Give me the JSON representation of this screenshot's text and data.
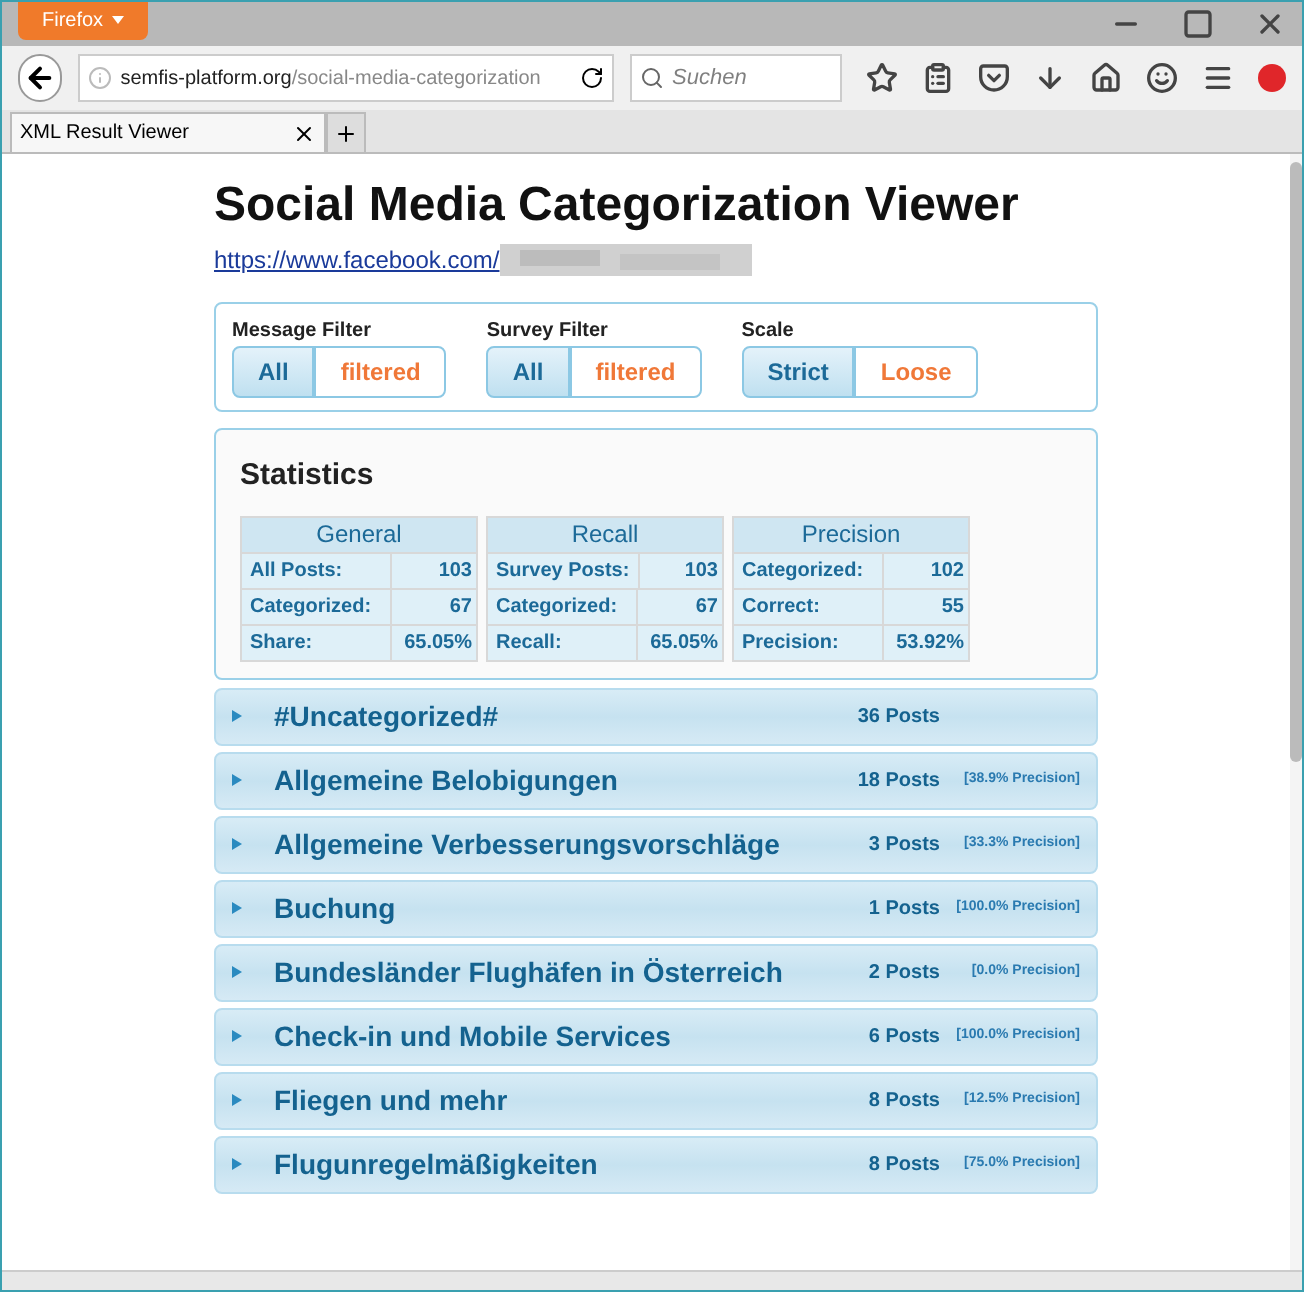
{
  "browser": {
    "menu_button": "Firefox",
    "url_host": "semfis-platform.org",
    "url_path": "/social-media-categorization",
    "search": {
      "placeholder": "Suchen"
    },
    "tabs": [
      {
        "label": "XML Result Viewer",
        "selected": true
      }
    ]
  },
  "page": {
    "title": "Social Media Categorization Viewer",
    "link": "https://www.facebook.com/",
    "filters": [
      {
        "label": "Message Filter",
        "options": [
          {
            "label": "All",
            "selected": true
          },
          {
            "label": "filtered",
            "selected": false
          }
        ]
      },
      {
        "label": "Survey Filter",
        "options": [
          {
            "label": "All",
            "selected": true
          },
          {
            "label": "filtered",
            "selected": false
          }
        ]
      },
      {
        "label": "Scale",
        "options": [
          {
            "label": "Strict",
            "selected": true
          },
          {
            "label": "Loose",
            "selected": false
          }
        ]
      }
    ],
    "statistics": {
      "title": "Statistics",
      "tables": [
        {
          "heading": "General",
          "rows": [
            [
              "All Posts:",
              "103"
            ],
            [
              "Categorized:",
              "67"
            ],
            [
              "Share:",
              "65.05%"
            ]
          ]
        },
        {
          "heading": "Recall",
          "rows": [
            [
              "Survey Posts:",
              "103"
            ],
            [
              "Categorized:",
              "67"
            ],
            [
              "Recall:",
              "65.05%"
            ]
          ]
        },
        {
          "heading": "Precision",
          "rows": [
            [
              "Categorized:",
              "102"
            ],
            [
              "Correct:",
              "55"
            ],
            [
              "Precision:",
              "53.92%"
            ]
          ]
        }
      ]
    },
    "categories": [
      {
        "name": "#Uncategorized#",
        "posts": "36 Posts",
        "expanded": false
      },
      {
        "name": "Allgemeine Belobigungen",
        "posts": "18 Posts",
        "precision": "[38.9% Precision]",
        "expanded": false
      },
      {
        "name": "Allgemeine Verbesserungsvorschläge",
        "posts": "3 Posts",
        "precision": "[33.3% Precision]",
        "expanded": false
      },
      {
        "name": "Buchung",
        "posts": "1 Posts",
        "precision": "[100.0% Precision]",
        "expanded": false
      },
      {
        "name": "Bundesländer Flughäfen in Österreich",
        "posts": "2 Posts",
        "precision": "[0.0% Precision]",
        "expanded": false
      },
      {
        "name": "Check-in und Mobile Services",
        "posts": "6 Posts",
        "precision": "[100.0% Precision]",
        "expanded": false
      },
      {
        "name": "Fliegen und mehr",
        "posts": "8 Posts",
        "precision": "[12.5% Precision]",
        "expanded": false
      },
      {
        "name": "Flugunregelmäßigkeiten",
        "posts": "8 Posts",
        "precision": "[75.0% Precision]",
        "expanded": false
      }
    ]
  }
}
